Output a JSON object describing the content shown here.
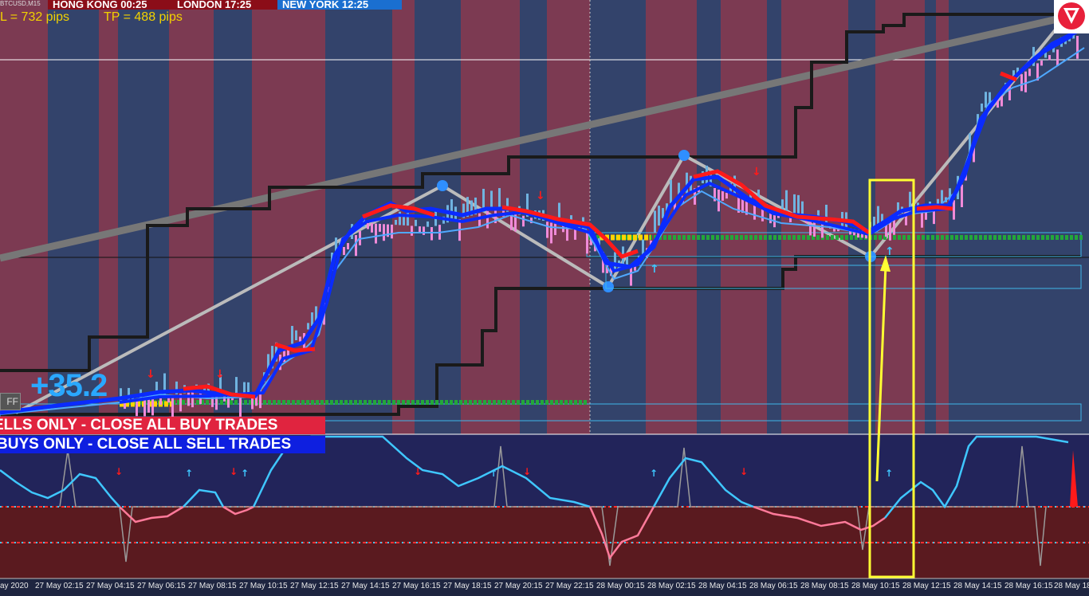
{
  "symbol": "BTCUSD,M15",
  "clocks": {
    "hongkong": "HONG KONG 00:25",
    "london": "LONDON   17:25",
    "newyork": "NEW YORK  12:25"
  },
  "info": {
    "sl": "L = 732 pips",
    "tp": "TP = 488 pips"
  },
  "profit": "+35.2",
  "ff_button": "FF",
  "banners": {
    "sell": "ELLS ONLY - CLOSE ALL BUY TRADES",
    "buy": "BUYS ONLY - CLOSE ALL SELL TRADES"
  },
  "colors": {
    "bg_blue": "#33436b",
    "bg_red": "#7c3a52",
    "oscillator_bg": "#22245a",
    "oscillator_low_bg": "#5a1a1f",
    "ma_blue": "#0a2bff",
    "ma_red": "#ff1a1a",
    "highlight": "#ffff33"
  },
  "time_axis": [
    "ay 2020",
    "27 May 02:15",
    "27 May 04:15",
    "27 May 06:15",
    "27 May 08:15",
    "27 May 10:15",
    "27 May 12:15",
    "27 May 14:15",
    "27 May 16:15",
    "27 May 18:15",
    "27 May 20:15",
    "27 May 22:15",
    "28 May 00:15",
    "28 May 02:15",
    "28 May 04:15",
    "28 May 06:15",
    "28 May 08:15",
    "28 May 10:15",
    "28 May 12:15",
    "28 May 14:15",
    "28 May 16:15",
    "28 May 18"
  ]
}
